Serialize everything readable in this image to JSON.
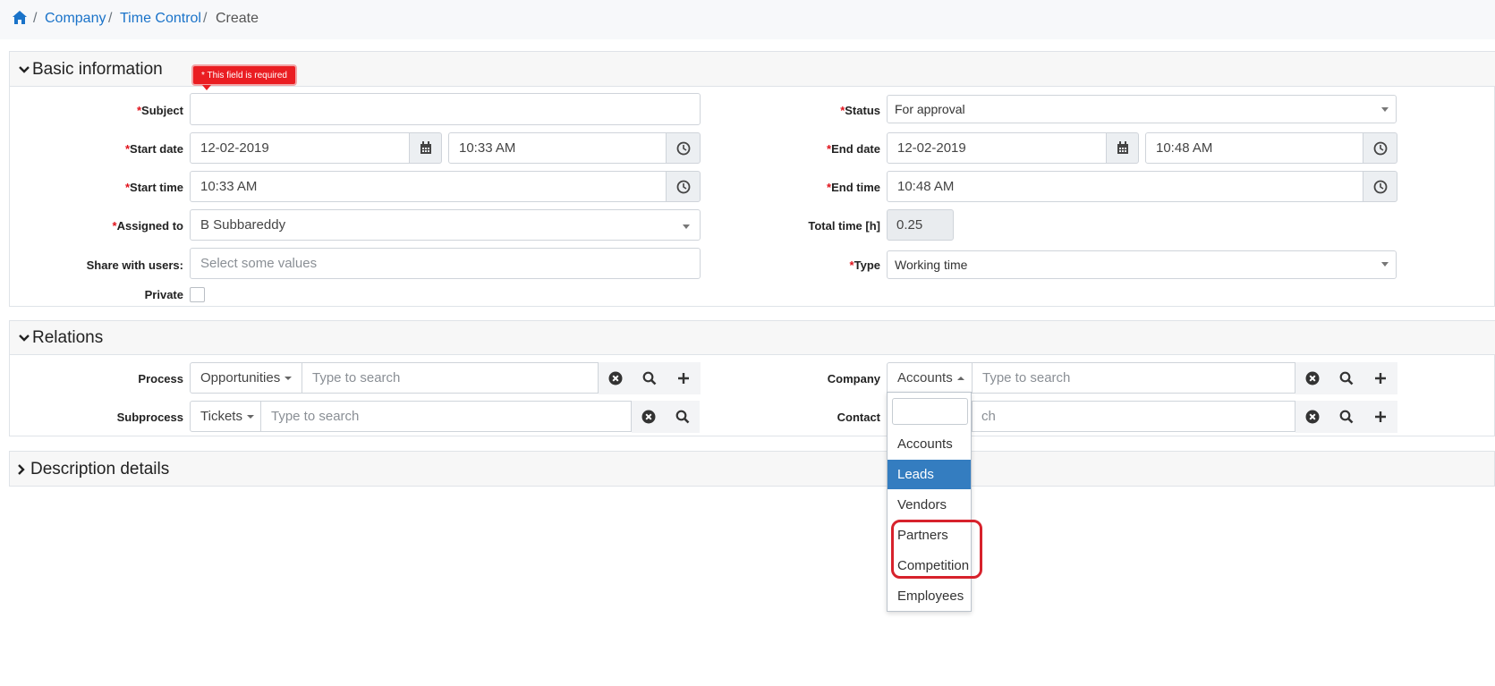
{
  "breadcrumb": {
    "items": [
      "Company",
      "Time Control",
      "Create"
    ],
    "separator": "/"
  },
  "sections": {
    "basic": "Basic information",
    "relations": "Relations",
    "description": "Description details"
  },
  "tooltip": "* This field is required",
  "required_mark": "*",
  "basic": {
    "subject_label": "Subject",
    "start_date_label": "Start date",
    "start_date": "12-02-2019",
    "start_date_time": "10:33 AM",
    "start_time_label": "Start time",
    "start_time": "10:33 AM",
    "assigned_label": "Assigned to",
    "assigned_value": "B Subbareddy",
    "share_label": "Share with users:",
    "share_placeholder": "Select some values",
    "private_label": "Private",
    "status_label": "Status",
    "status_value": "For approval",
    "end_date_label": "End date",
    "end_date": "12-02-2019",
    "end_date_time": "10:48 AM",
    "end_time_label": "End time",
    "end_time": "10:48 AM",
    "total_label": "Total time [h]",
    "total_value": "0.25",
    "type_label": "Type",
    "type_value": "Working time"
  },
  "relations": {
    "process_label": "Process",
    "process_module": "Opportunities",
    "subprocess_label": "Subprocess",
    "subprocess_module": "Tickets",
    "company_label": "Company",
    "company_module": "Accounts",
    "contact_label": "Contact",
    "contact_partial": "ch",
    "search_placeholder": "Type to search"
  },
  "dropdown": {
    "items": [
      "Accounts",
      "Leads",
      "Vendors",
      "Partners",
      "Competition",
      "Employees"
    ],
    "active": "Leads"
  },
  "colors": {
    "link": "#1a73c9",
    "required": "#e0121b",
    "active_item": "#347dc0",
    "highlight": "#d7222c"
  }
}
